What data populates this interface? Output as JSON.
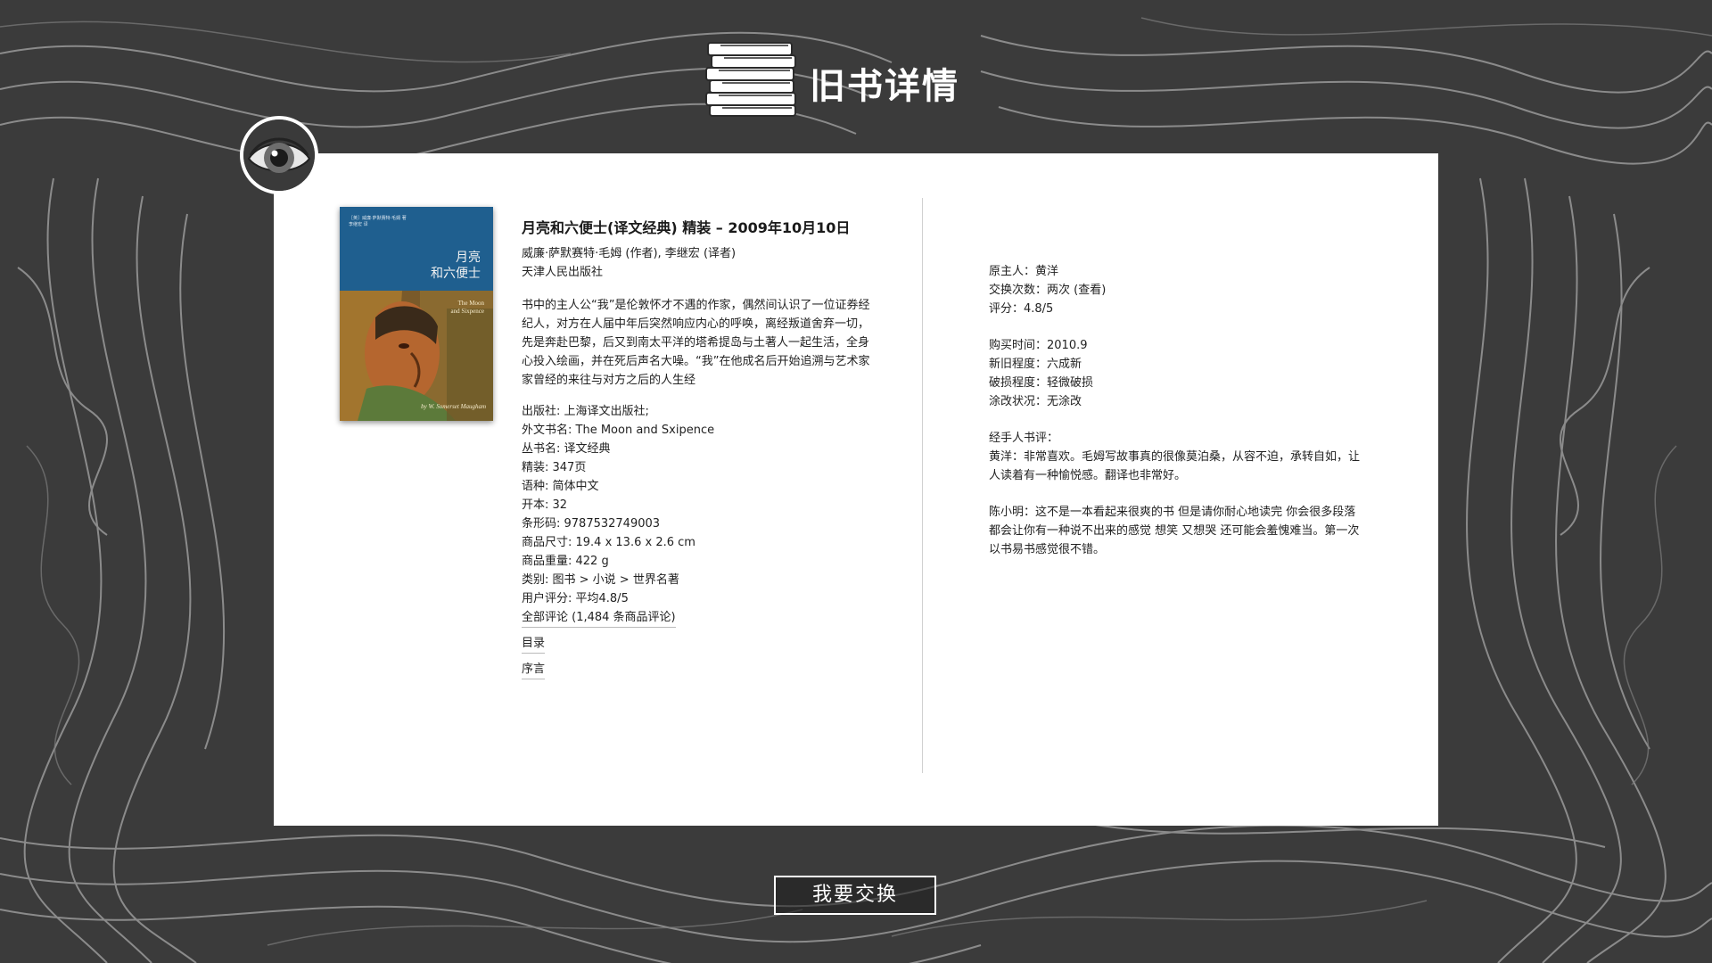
{
  "header": {
    "title": "旧书详情",
    "icon": "stack-of-books-icon"
  },
  "badge": {
    "icon": "eye-icon"
  },
  "book": {
    "cover": {
      "title_cn": "月亮\n和六便士",
      "title_en": "The Moon\nand Sixpence",
      "small_text": "［英］威廉·萨默赛特·毛姆 著\n李继宏 译",
      "author_en": "by W. Somerset Maugham"
    },
    "title": "月亮和六便士(译文经典) 精装 – 2009年10月10日",
    "authors": "威廉·萨默赛特·毛姆 (作者), 李继宏 (译者)",
    "publisher_line": "天津人民出版社",
    "summary": "书中的主人公“我”是伦敦怀才不遇的作家，偶然间认识了一位证券经纪人，对方在人届中年后突然响应内心的呼唤，离经叛道舍弃一切，先是奔赴巴黎，后又到南太平洋的塔希提岛与土著人一起生活，全身心投入绘画，并在死后声名大噪。“我”在他成名后开始追溯与艺术家家曾经的来往与对方之后的人生经",
    "specs": [
      "出版社: 上海译文出版社;",
      "外文书名: The Moon and Sxipence",
      "丛书名: 译文经典",
      "精装: 347页",
      "语种: 简体中文",
      "开本: 32",
      "条形码: 9787532749003",
      "商品尺寸: 19.4 x 13.6 x 2.6 cm",
      "商品重量: 422 g",
      "类别: 图书 > 小说 > 世界名著",
      "用户评分: 平均4.8/5"
    ],
    "all_reviews": "全部评论 (1,484 条商品评论)",
    "toc_link": "目录",
    "preface_link": "序言"
  },
  "owner": {
    "owner": "原主人：黄洋",
    "exchange_count": "交换次数：两次 (查看)",
    "rating": "评分：4.8/5"
  },
  "condition": {
    "purchase_time": "购买时间：2010.9",
    "newness": "新旧程度：六成新",
    "damage": "破损程度：轻微破损",
    "markings": "涂改状况：无涂改"
  },
  "reviews": {
    "heading": "经手人书评：",
    "items": [
      "黄洋：非常喜欢。毛姆写故事真的很像莫泊桑，从容不迫，承转自如，让人读着有一种愉悦感。翻译也非常好。",
      "陈小明：这不是一本看起来很爽的书 但是请你耐心地读完 你会很多段落都会让你有一种说不出来的感觉 想笑 又想哭 还可能会羞愧难当。第一次以书易书感觉很不错。"
    ]
  },
  "actions": {
    "exchange_label": "我要交换"
  },
  "colors": {
    "background": "#3a3a3a",
    "panel": "#ffffff",
    "cover_blue": "#1f5f8f"
  }
}
